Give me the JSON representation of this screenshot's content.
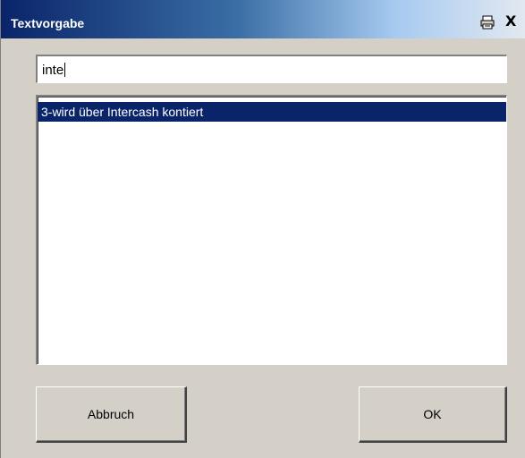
{
  "window": {
    "title": "Textvorgabe",
    "close_glyph": "X",
    "icons": [
      "printer-icon",
      "close-icon"
    ]
  },
  "search": {
    "value": "inte"
  },
  "list": {
    "items": [
      {
        "label": "3-wird über Intercash kontiert",
        "selected": true
      }
    ]
  },
  "buttons": {
    "cancel_label": "Abbruch",
    "ok_label": "OK"
  },
  "colors": {
    "titlebar_start": "#0a246a",
    "selection": "#0a246a",
    "face": "#d4d0c8"
  }
}
